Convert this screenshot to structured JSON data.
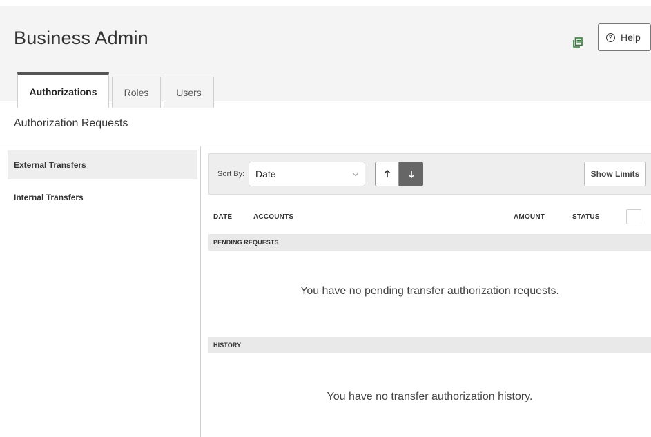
{
  "header": {
    "title": "Business Admin",
    "print_icon": "print-icon",
    "help_icon": "help-circle-icon",
    "help_label": "Help"
  },
  "tabs": [
    {
      "label": "Authorizations",
      "active": true
    },
    {
      "label": "Roles",
      "active": false
    },
    {
      "label": "Users",
      "active": false
    }
  ],
  "section": {
    "title": "Authorization Requests"
  },
  "sidebar": {
    "items": [
      {
        "label": "External Transfers",
        "active": true
      },
      {
        "label": "Internal Transfers",
        "active": false
      }
    ]
  },
  "toolbar": {
    "sort_label": "Sort By:",
    "sort_value": "Date",
    "sort_asc_icon": "arrow-up-icon",
    "sort_desc_icon": "arrow-down-icon",
    "show_limits_label": "Show Limits"
  },
  "table": {
    "columns": [
      "DATE",
      "ACCOUNTS",
      "AMOUNT",
      "STATUS"
    ]
  },
  "pending": {
    "title": "PENDING REQUESTS",
    "empty_message": "You have no pending transfer authorization requests."
  },
  "history": {
    "title": "HISTORY",
    "empty_message": "You have no transfer authorization history."
  },
  "colors": {
    "header_bg": "#f4f4f4",
    "active_tab_border": "#555555",
    "desc_button_bg": "#666666",
    "print_icon": "#2e7d32"
  }
}
